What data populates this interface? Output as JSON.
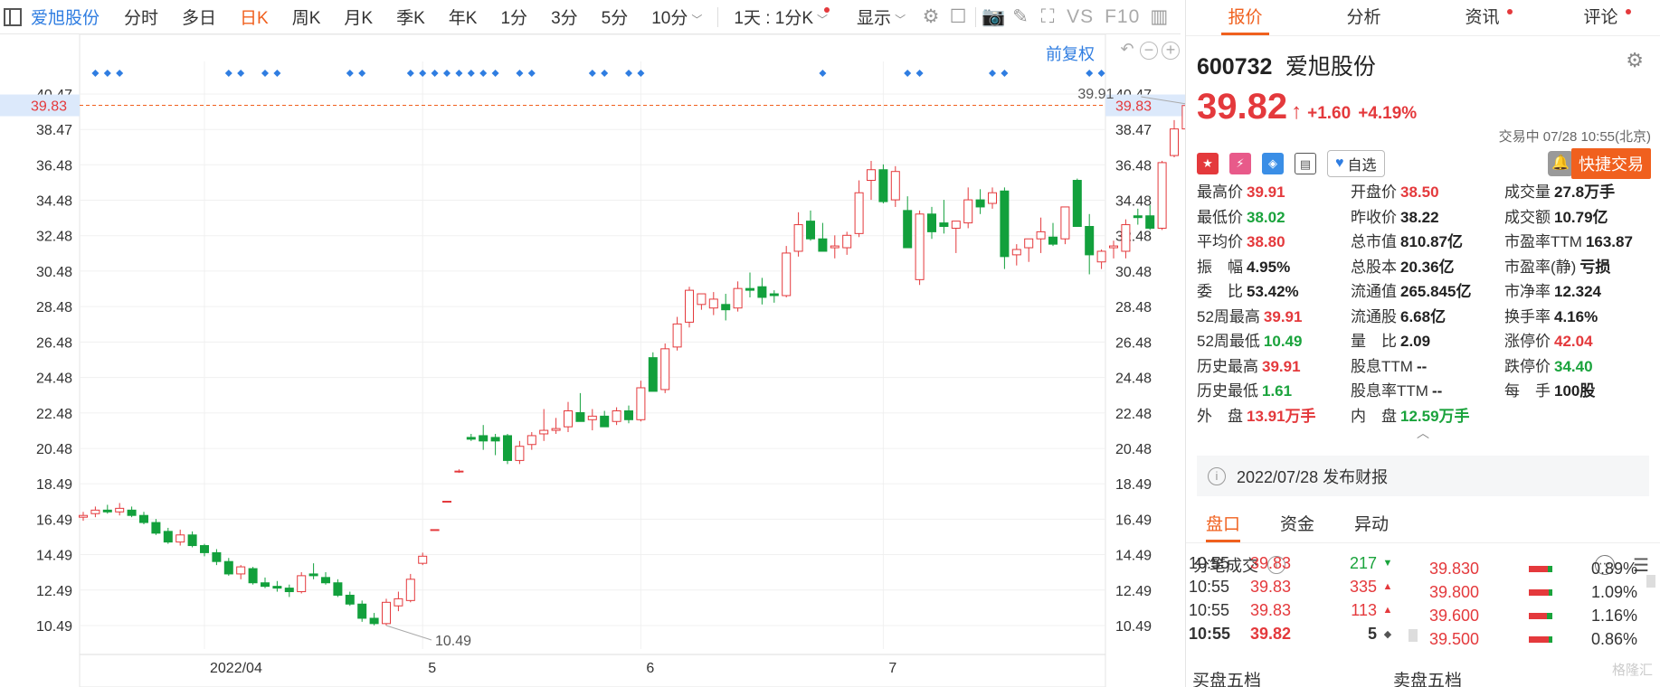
{
  "toolbar": {
    "stock_name": "爱旭股份",
    "periods": [
      "分时",
      "多日",
      "日K",
      "周K",
      "月K",
      "季K",
      "年K",
      "1分",
      "3分",
      "5分",
      "10分"
    ],
    "active_period": "日K",
    "multi_day": "1天 : 1分K",
    "display": "显示",
    "text_tools": [
      "VS",
      "F10"
    ]
  },
  "chart": {
    "adjust_label": "前复权",
    "current_price_label": "39.83",
    "high_annotation": "39.91",
    "low_annotation": "10.49",
    "colors": {
      "up": "#e4393c",
      "down": "#12a03c",
      "price_line": "#f0601e",
      "marker": "#2f7de1"
    }
  },
  "chart_data": {
    "type": "candlestick",
    "y_ticks": [
      40.47,
      38.47,
      36.48,
      34.48,
      32.48,
      30.48,
      28.48,
      26.48,
      24.48,
      22.48,
      20.48,
      18.49,
      16.49,
      14.49,
      12.49,
      10.49
    ],
    "ylim": [
      8.8,
      41.3
    ],
    "x_labels": [
      "2022/04",
      "5",
      "6",
      "7"
    ],
    "x_label_index": [
      10,
      28,
      46,
      66
    ],
    "marker_index": [
      1,
      2,
      3,
      12,
      13,
      15,
      16,
      22,
      23,
      27,
      28,
      29,
      30,
      31,
      32,
      33,
      34,
      36,
      37,
      42,
      43,
      45,
      46,
      61,
      68,
      69,
      75,
      76,
      83,
      84
    ],
    "candles": [
      [
        16.6,
        16.9,
        16.4,
        16.7
      ],
      [
        16.8,
        17.2,
        16.6,
        17.0
      ],
      [
        17.0,
        17.3,
        16.8,
        16.9
      ],
      [
        16.9,
        17.4,
        16.7,
        17.1
      ],
      [
        17.0,
        17.2,
        16.6,
        16.7
      ],
      [
        16.7,
        16.9,
        16.2,
        16.3
      ],
      [
        16.3,
        16.5,
        15.6,
        15.7
      ],
      [
        15.8,
        16.0,
        15.1,
        15.2
      ],
      [
        15.2,
        15.9,
        15.0,
        15.6
      ],
      [
        15.6,
        15.8,
        14.9,
        15.0
      ],
      [
        15.0,
        15.1,
        14.4,
        14.6
      ],
      [
        14.6,
        14.8,
        13.9,
        14.1
      ],
      [
        14.1,
        14.3,
        13.3,
        13.4
      ],
      [
        13.4,
        13.9,
        13.1,
        13.8
      ],
      [
        13.7,
        13.8,
        12.8,
        12.9
      ],
      [
        12.9,
        13.2,
        12.6,
        12.7
      ],
      [
        12.7,
        13.0,
        12.4,
        12.6
      ],
      [
        12.6,
        12.8,
        12.1,
        12.4
      ],
      [
        12.4,
        13.5,
        12.3,
        13.3
      ],
      [
        13.4,
        14.0,
        13.1,
        13.3
      ],
      [
        13.2,
        13.5,
        12.8,
        12.9
      ],
      [
        12.9,
        13.1,
        12.1,
        12.2
      ],
      [
        12.2,
        12.4,
        11.6,
        11.7
      ],
      [
        11.7,
        11.9,
        10.7,
        10.9
      ],
      [
        10.9,
        11.2,
        10.5,
        10.6
      ],
      [
        10.6,
        12.0,
        10.49,
        11.8
      ],
      [
        11.6,
        12.4,
        11.3,
        12.0
      ],
      [
        11.9,
        13.4,
        11.8,
        13.1
      ],
      [
        14.0,
        14.6,
        13.9,
        14.4
      ],
      [
        15.9,
        15.9,
        15.9,
        15.9
      ],
      [
        17.5,
        17.5,
        17.5,
        17.5
      ],
      [
        19.2,
        19.3,
        19.1,
        19.2
      ],
      [
        21.1,
        21.3,
        20.9,
        21.0
      ],
      [
        21.2,
        21.8,
        20.4,
        20.9
      ],
      [
        21.1,
        21.3,
        20.1,
        20.9
      ],
      [
        21.2,
        21.3,
        19.6,
        19.8
      ],
      [
        19.8,
        20.9,
        19.6,
        20.6
      ],
      [
        20.7,
        21.4,
        20.4,
        21.2
      ],
      [
        21.3,
        22.7,
        20.9,
        21.5
      ],
      [
        21.5,
        22.2,
        21.3,
        21.6
      ],
      [
        21.7,
        23.1,
        21.4,
        22.6
      ],
      [
        22.5,
        23.6,
        22.0,
        22.0
      ],
      [
        22.1,
        22.7,
        21.5,
        22.3
      ],
      [
        22.3,
        22.6,
        21.8,
        21.7
      ],
      [
        22.0,
        22.8,
        21.8,
        22.6
      ],
      [
        22.6,
        22.9,
        21.9,
        22.1
      ],
      [
        22.1,
        24.3,
        22.0,
        23.9
      ],
      [
        25.6,
        25.9,
        23.7,
        23.7
      ],
      [
        23.8,
        26.4,
        23.6,
        26.1
      ],
      [
        26.2,
        27.9,
        26.0,
        27.5
      ],
      [
        27.6,
        29.6,
        27.3,
        29.4
      ],
      [
        28.6,
        29.2,
        28.3,
        29.2
      ],
      [
        28.4,
        29.3,
        28.0,
        28.9
      ],
      [
        28.6,
        29.2,
        27.7,
        28.3
      ],
      [
        28.4,
        29.9,
        28.2,
        29.5
      ],
      [
        29.5,
        30.4,
        29.0,
        29.4
      ],
      [
        29.6,
        30.1,
        28.6,
        29.0
      ],
      [
        29.2,
        29.4,
        28.7,
        29.1
      ],
      [
        29.1,
        31.9,
        29.0,
        31.5
      ],
      [
        31.6,
        33.8,
        31.3,
        33.1
      ],
      [
        33.3,
        33.9,
        32.2,
        32.3
      ],
      [
        32.3,
        33.2,
        31.6,
        31.6
      ],
      [
        31.8,
        32.5,
        31.2,
        31.9
      ],
      [
        31.8,
        32.7,
        31.4,
        32.5
      ],
      [
        32.6,
        35.6,
        32.4,
        34.9
      ],
      [
        35.6,
        36.7,
        34.5,
        36.2
      ],
      [
        36.2,
        36.5,
        34.3,
        34.4
      ],
      [
        34.5,
        36.4,
        34.1,
        36.1
      ],
      [
        33.9,
        34.7,
        31.8,
        31.8
      ],
      [
        30.0,
        33.9,
        29.7,
        33.7
      ],
      [
        33.7,
        34.1,
        32.3,
        32.7
      ],
      [
        33.2,
        34.5,
        32.6,
        33.0
      ],
      [
        32.9,
        33.3,
        31.5,
        33.3
      ],
      [
        33.2,
        35.2,
        32.9,
        34.5
      ],
      [
        34.5,
        35.1,
        33.7,
        34.1
      ],
      [
        34.3,
        35.2,
        34.0,
        34.9
      ],
      [
        35.0,
        35.2,
        30.6,
        31.3
      ],
      [
        31.4,
        32.0,
        30.8,
        31.7
      ],
      [
        31.8,
        32.1,
        31.0,
        32.3
      ],
      [
        32.3,
        33.5,
        31.5,
        32.7
      ],
      [
        32.4,
        33.2,
        31.9,
        32.0
      ],
      [
        32.3,
        34.0,
        32.0,
        34.1
      ],
      [
        35.6,
        35.7,
        33.0,
        33.0
      ],
      [
        33.0,
        33.7,
        30.3,
        31.4
      ],
      [
        31.0,
        31.7,
        30.6,
        31.6
      ],
      [
        31.8,
        32.2,
        31.2,
        31.9
      ],
      [
        31.6,
        33.4,
        31.2,
        33.1
      ],
      [
        33.6,
        34.0,
        33.1,
        33.5
      ],
      [
        33.6,
        34.2,
        32.8,
        32.9
      ],
      [
        32.9,
        36.7,
        32.8,
        36.6
      ],
      [
        37.0,
        39.0,
        36.9,
        38.5
      ],
      [
        38.5,
        39.91,
        38.02,
        39.82
      ]
    ]
  },
  "tabs": [
    "报价",
    "分析",
    "资讯",
    "评论"
  ],
  "stock": {
    "code": "600732",
    "name": "爱旭股份",
    "price": "39.82",
    "change": "+1.60",
    "change_pct": "+4.19%",
    "status": "交易中 07/28 10:55(北京)",
    "fav_label": "自选",
    "quick_trade": "快捷交易"
  },
  "quote": [
    {
      "label": "最高价",
      "value": "39.91",
      "cls": "up"
    },
    {
      "label": "开盘价",
      "value": "38.50",
      "cls": "up"
    },
    {
      "label": "成交量",
      "value": "27.8万手",
      "cls": "neu"
    },
    {
      "label": "最低价",
      "value": "38.02",
      "cls": "down"
    },
    {
      "label": "昨收价",
      "value": "38.22",
      "cls": "neu"
    },
    {
      "label": "成交额",
      "value": "10.79亿",
      "cls": "neu"
    },
    {
      "label": "平均价",
      "value": "38.80",
      "cls": "up"
    },
    {
      "label": "总市值",
      "value": "810.87亿",
      "cls": "neu"
    },
    {
      "label": "市盈率TTM",
      "value": "163.87",
      "cls": "neu"
    },
    {
      "label": "振　幅",
      "value": "4.95%",
      "cls": "neu"
    },
    {
      "label": "总股本",
      "value": "20.36亿",
      "cls": "neu"
    },
    {
      "label": "市盈率(静)",
      "value": "亏损",
      "cls": "neu"
    },
    {
      "label": "委　比",
      "value": "53.42%",
      "cls": "neu"
    },
    {
      "label": "流通值",
      "value": "265.845亿",
      "cls": "neu"
    },
    {
      "label": "市净率",
      "value": "12.324",
      "cls": "neu"
    },
    {
      "label": "52周最高",
      "value": "39.91",
      "cls": "up"
    },
    {
      "label": "流通股",
      "value": "6.68亿",
      "cls": "neu"
    },
    {
      "label": "换手率",
      "value": "4.16%",
      "cls": "neu"
    },
    {
      "label": "52周最低",
      "value": "10.49",
      "cls": "down"
    },
    {
      "label": "量　比",
      "value": "2.09",
      "cls": "neu"
    },
    {
      "label": "涨停价",
      "value": "42.04",
      "cls": "up"
    },
    {
      "label": "历史最高",
      "value": "39.91",
      "cls": "up"
    },
    {
      "label": "股息TTM",
      "value": "--",
      "cls": "neu"
    },
    {
      "label": "跌停价",
      "value": "34.40",
      "cls": "down"
    },
    {
      "label": "历史最低",
      "value": "1.61",
      "cls": "down"
    },
    {
      "label": "股息率TTM",
      "value": "--",
      "cls": "neu"
    },
    {
      "label": "每　手",
      "value": "100股",
      "cls": "neu"
    },
    {
      "label": "外　盘",
      "value": "13.91万手",
      "cls": "up"
    },
    {
      "label": "内　盘",
      "value": "12.59万手",
      "cls": "down"
    }
  ],
  "report": "2022/07/28  发布财报",
  "subtabs": [
    "盘口",
    "资金",
    "异动"
  ],
  "trades_title": "分笔成交",
  "trades": [
    {
      "time": "10:55",
      "price": "39.83",
      "vol": "217",
      "dir": "▼",
      "dcolor": "#1aa33c",
      "vcolor": "#1aa33c",
      "bold": false
    },
    {
      "time": "10:55",
      "price": "39.83",
      "vol": "335",
      "dir": "▲",
      "dcolor": "#e4393c",
      "vcolor": "#e4393c",
      "bold": false
    },
    {
      "time": "10:55",
      "price": "39.83",
      "vol": "113",
      "dir": "▲",
      "dcolor": "#e4393c",
      "vcolor": "#e4393c",
      "bold": false
    },
    {
      "time": "10:55",
      "price": "39.82",
      "vol": "5",
      "dir": "◆",
      "dcolor": "#555",
      "vcolor": "#333",
      "bold": true
    }
  ],
  "levels": [
    {
      "price": "39.830",
      "pct": "0.89%",
      "green": 20
    },
    {
      "price": "39.800",
      "pct": "1.09%",
      "green": 15
    },
    {
      "price": "39.600",
      "pct": "1.16%",
      "green": 25
    },
    {
      "price": "39.500",
      "pct": "0.86%",
      "green": 15
    }
  ],
  "bottom": {
    "buy5": "买盘五档",
    "sell5": "卖盘五档"
  },
  "watermark": "格隆汇"
}
